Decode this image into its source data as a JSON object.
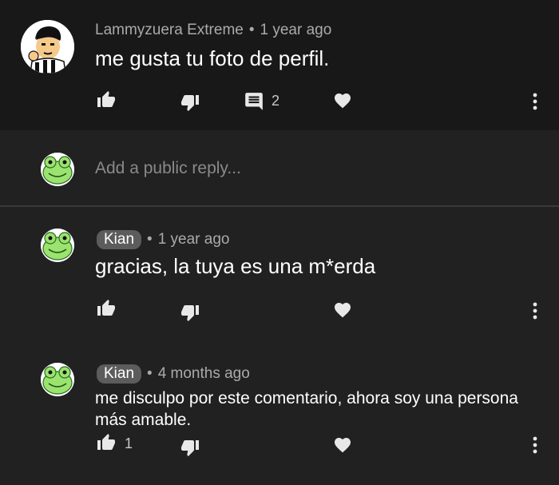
{
  "comment": {
    "author": "Lammyzuera Extreme",
    "time": "1 year ago",
    "text": "me gusta tu foto de perfil.",
    "reply_count": "2"
  },
  "reply_box": {
    "placeholder": "Add a public reply..."
  },
  "replies": [
    {
      "author": "Kian",
      "time": "1 year ago",
      "text": "gracias, la tuya es una m*erda",
      "like_count": ""
    },
    {
      "author": "Kian",
      "time": "4 months ago",
      "text_line1": "me disculpo por este comentario, ahora soy una persona",
      "text_line2": "más amable.",
      "like_count": "1"
    }
  ],
  "separator": "•",
  "icons": [
    "thumb-up-icon",
    "thumb-down-icon",
    "reply-icon",
    "heart-icon",
    "more-vertical-icon"
  ],
  "colors": {
    "background": "#212121",
    "top_comment_bg": "#181818",
    "meta_text": "#aaaaaa",
    "chip_bg": "#5c5c5c",
    "avatar_green": "#9be36f"
  }
}
